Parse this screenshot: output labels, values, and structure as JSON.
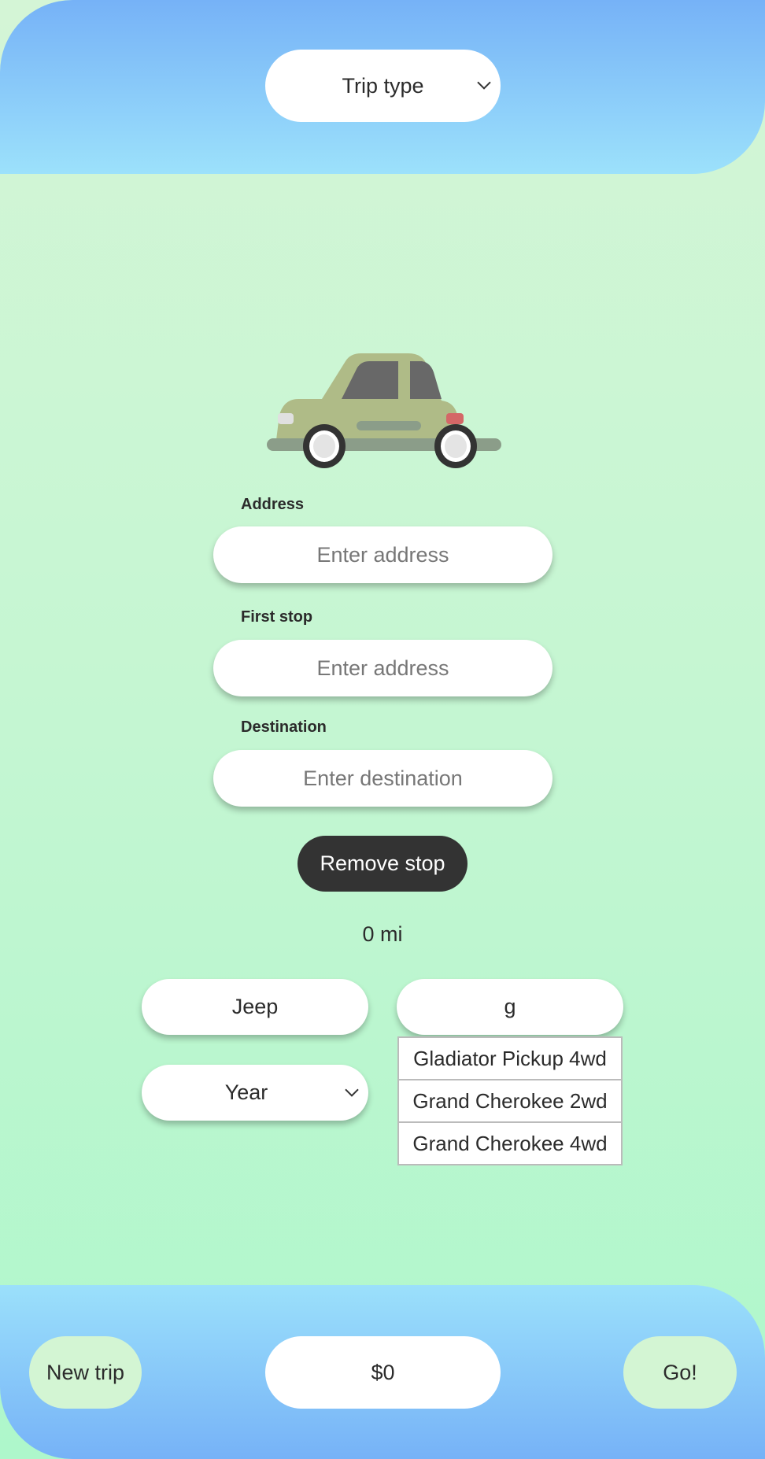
{
  "header": {
    "trip_type": {
      "label": "Trip type",
      "icon": "chevron-down-icon"
    }
  },
  "form": {
    "address": {
      "label": "Address",
      "placeholder": "Enter address",
      "value": ""
    },
    "first_stop": {
      "label": "First stop",
      "placeholder": "Enter address",
      "value": ""
    },
    "destination": {
      "label": "Destination",
      "placeholder": "Enter destination",
      "value": ""
    },
    "remove_stop_label": "Remove stop",
    "distance": "0 mi"
  },
  "vehicle": {
    "make": "Jeep",
    "model_query": "g",
    "year": {
      "label": "Year",
      "icon": "chevron-down-icon"
    },
    "model_suggestions": [
      "Gladiator Pickup 4wd",
      "Grand Cherokee 2wd",
      "Grand Cherokee 4wd"
    ]
  },
  "footer": {
    "new_trip_label": "New trip",
    "cost": "$0",
    "go_label": "Go!"
  },
  "colors": {
    "header_top": "#76b2f7",
    "header_bottom": "#9ce1fb",
    "bg_top": "#d4f5d6",
    "bg_bottom": "#aef7cb",
    "button_dark": "#333333",
    "button_green": "#d3f5d3",
    "car_body": "#afbb87"
  }
}
